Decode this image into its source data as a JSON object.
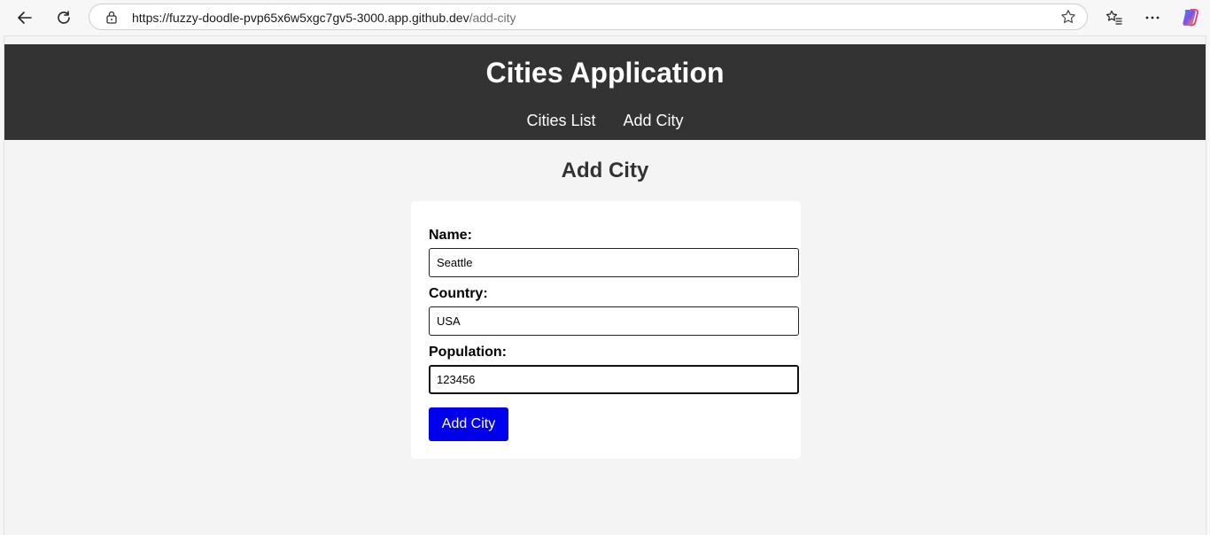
{
  "browser": {
    "url_host": "https://fuzzy-doodle-pvp65x6w5xgc7gv5-3000.app.github.dev",
    "url_path": "/add-city",
    "icons": [
      "back-icon",
      "reload-icon",
      "lock-icon",
      "star-icon",
      "favorites-icon",
      "more-icon",
      "copilot-icon"
    ]
  },
  "header": {
    "title": "Cities Application",
    "nav": {
      "cities_list": "Cities List",
      "add_city": "Add City"
    }
  },
  "main": {
    "heading": "Add City",
    "form": {
      "name_label": "Name:",
      "name_value": "Seattle",
      "country_label": "Country:",
      "country_value": "USA",
      "population_label": "Population:",
      "population_value": "123456",
      "submit_label": "Add City"
    }
  },
  "colors": {
    "header_bg": "#333333",
    "submit_bg": "#0000ee",
    "page_bg": "#f4f4f4"
  }
}
